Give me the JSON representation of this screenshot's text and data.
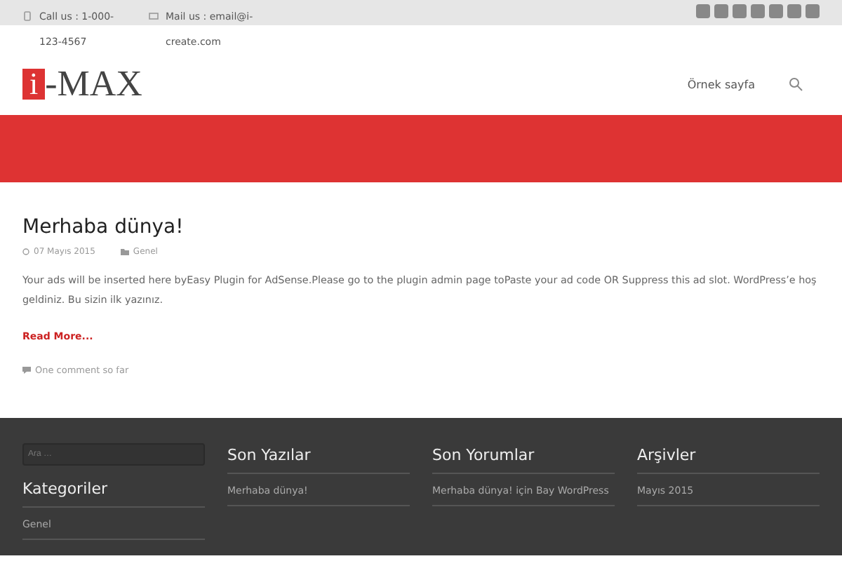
{
  "topbar": {
    "phone": "Call us : 1-000-123-4567",
    "mail": "Mail us : email@i-create.com"
  },
  "logo": {
    "mark": "i",
    "text": "-MAX"
  },
  "nav": {
    "items": [
      "Örnek sayfa"
    ]
  },
  "post": {
    "title": "Merhaba dünya!",
    "date": "07 Mayıs 2015",
    "category": "Genel",
    "excerpt": "Your ads will be inserted here byEasy Plugin for AdSense.Please go to the plugin admin page toPaste your ad code OR Suppress this ad slot. WordPress’e hoş geldiniz. Bu sizin ilk yazınız.",
    "read_more": "Read More...",
    "comments": "One comment so far"
  },
  "footer": {
    "search": {
      "placeholder": "Ara …"
    },
    "widgets": [
      {
        "title": "Kategoriler",
        "items": [
          "Genel"
        ]
      },
      {
        "title": "Son Yazılar",
        "items": [
          "Merhaba dünya!"
        ]
      },
      {
        "title": "Son Yorumlar",
        "items": [
          "Merhaba dünya! için Bay WordPress"
        ]
      },
      {
        "title": "Arşivler",
        "items": [
          "Mayıs 2015"
        ]
      }
    ]
  }
}
